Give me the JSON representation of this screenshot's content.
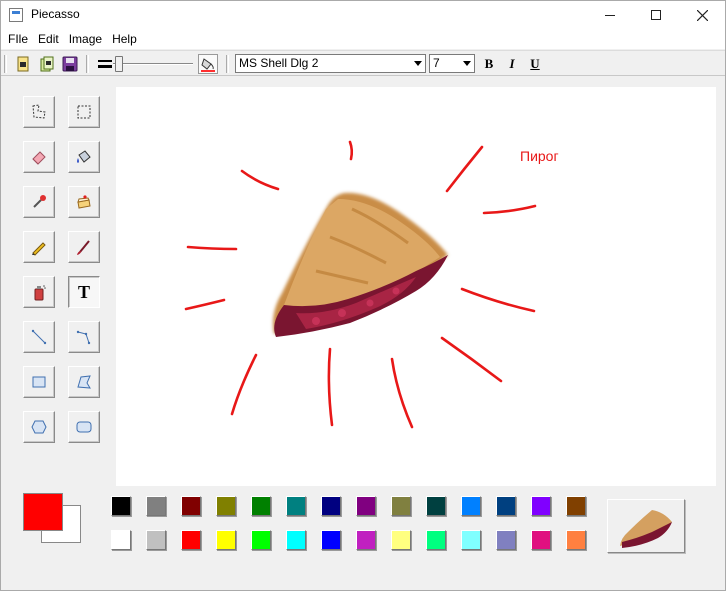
{
  "window": {
    "title": "Piecasso"
  },
  "menu": [
    "FIle",
    "Edit",
    "Image",
    "Help"
  ],
  "toolbar": {
    "font_name": "MS Shell Dlg 2",
    "font_size": "7",
    "bold_label": "B",
    "italic_label": "I",
    "underline_label": "U"
  },
  "tools": [
    {
      "name": "free-select-tool"
    },
    {
      "name": "rect-select-tool"
    },
    {
      "name": "eraser-tool"
    },
    {
      "name": "fill-tool"
    },
    {
      "name": "eyedropper-tool"
    },
    {
      "name": "stamp-tool"
    },
    {
      "name": "pencil-tool"
    },
    {
      "name": "brush-tool"
    },
    {
      "name": "spray-tool"
    },
    {
      "name": "text-tool",
      "active": true
    },
    {
      "name": "line-tool"
    },
    {
      "name": "polyline-tool"
    },
    {
      "name": "rectangle-tool"
    },
    {
      "name": "polygon-tool"
    },
    {
      "name": "ellipse-tool"
    },
    {
      "name": "rounded-rect-tool"
    }
  ],
  "canvas": {
    "text": "Пирог"
  },
  "colors": {
    "primary": "#ff0000",
    "secondary": "#ffffff",
    "palette_row1": [
      "#000000",
      "#808080",
      "#800000",
      "#808000",
      "#008000",
      "#008080",
      "#000080",
      "#800080",
      "#808040",
      "#004040",
      "#0080ff",
      "#004080",
      "#8000ff",
      "#804000"
    ],
    "palette_row2": [
      "#ffffff",
      "#c0c0c0",
      "#ff0000",
      "#ffff00",
      "#00ff00",
      "#00ffff",
      "#0000ff",
      "#c020c0",
      "#ffff80",
      "#00ff80",
      "#80ffff",
      "#8080c0",
      "#e01080",
      "#ff8040"
    ]
  }
}
